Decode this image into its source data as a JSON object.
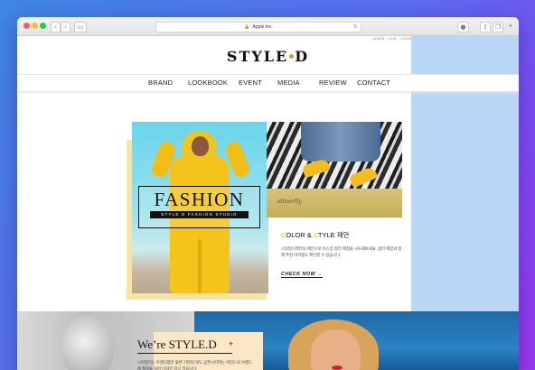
{
  "browser": {
    "address": "Apple Inc.",
    "nav_back": "‹",
    "nav_forward": "›",
    "sidebar": "▭",
    "download": "●",
    "share": "⇧",
    "tabs": "❐",
    "new_tab": "+",
    "reload": "↻",
    "lock": "🔒"
  },
  "site": {
    "util_links": "ADMIN · JOIN · LOGIN",
    "logo_left": "STYLE",
    "logo_right": "D"
  },
  "nav": {
    "items": [
      "BRAND",
      "LOOKBOOK",
      "EVENT",
      "MEDIA",
      "REVIEW",
      "CONTACT"
    ]
  },
  "hero": {
    "fashion_title": "FASHION",
    "studio_label": "STYLE.D FASHION STUDIO",
    "ledge_writing": "ellmerlly"
  },
  "promo": {
    "heading_c": "C",
    "heading_rest1": "OLOR & ",
    "heading_s": "S",
    "heading_rest2": "TYLE 제안",
    "body": "스타일디렉터의 제안으로 퍼스널 컬러 매칭을 시도해보세요. 컬러 매칭과 함께 추천 아이템도 확인할 수 있습니다.",
    "cta": "CHECK NOW →"
  },
  "about": {
    "title": "We’re STYLE.D",
    "plus": "+",
    "body": "스타일디는 트렌디함은 물론 기본의 멋도 공존시키려는 마인드로 브랜드에 철학을 담아 디자인 하고 있습니다."
  },
  "colors": {
    "accent_gold": "#e0b534",
    "side_blue": "#b9d6f7",
    "hoodie_yellow": "#f4c41c"
  }
}
